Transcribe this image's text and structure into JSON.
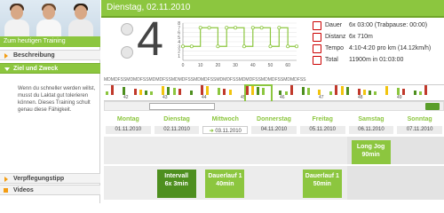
{
  "sidebar": {
    "title": "Zum heutigen Training",
    "items": [
      {
        "label": "Beschreibung",
        "active": false
      },
      {
        "label": "Ziel und Zweck",
        "active": true
      },
      {
        "label": "Verpflegungstipp",
        "active": false
      },
      {
        "label": "Videos",
        "active": false
      }
    ],
    "description": "Wenn du schneller werden willst, musst du Laktat gut tolerieren können. Dieses Training schult genau diese Fähigkeit."
  },
  "header": {
    "title": "Dienstag, 02.11.2010"
  },
  "workout_number": "4",
  "stats": [
    {
      "icon": "clock-icon",
      "label": "Dauer",
      "value": "6x 03:00 (Trabpause: 00:00)"
    },
    {
      "icon": "distance-icon",
      "label": "Distanz",
      "value": "6x 710m"
    },
    {
      "icon": "speed-icon",
      "label": "Tempo",
      "value": "4:10-4:20 pro km (14.12km/h)"
    },
    {
      "icon": "runner-icon",
      "label": "Total",
      "value": "11900m in 01:03:00"
    }
  ],
  "chart_data": {
    "type": "line",
    "x": [
      0,
      5,
      10,
      15,
      20,
      25,
      30,
      35,
      40,
      45,
      50,
      55,
      60,
      65
    ],
    "values": [
      3,
      3,
      7,
      7,
      3,
      7,
      7,
      3,
      7,
      7,
      3,
      7,
      3,
      3
    ],
    "xticks": [
      "0",
      "10",
      "20",
      "30",
      "40",
      "50",
      "60"
    ],
    "yticks": [
      "1",
      "2",
      "3",
      "4",
      "5",
      "6",
      "7",
      "8"
    ],
    "ylim": [
      0,
      8
    ],
    "xlim": [
      0,
      65
    ],
    "color": "#8cc63f"
  },
  "timeline": {
    "day_letters": "MDMDFSS",
    "weeks": [
      "42",
      "43",
      "44",
      "45",
      "46",
      "47",
      "48",
      "49"
    ],
    "months": [
      "Oktober '10",
      "November '10"
    ]
  },
  "calendar": {
    "days": [
      {
        "name": "Montag",
        "date": "01.11.2010",
        "today": false
      },
      {
        "name": "Dienstag",
        "date": "02.11.2010",
        "today": false
      },
      {
        "name": "Mittwoch",
        "date": "03.11.2010",
        "today": true
      },
      {
        "name": "Donnerstag",
        "date": "04.11.2010",
        "today": false
      },
      {
        "name": "Freitag",
        "date": "05.11.2010",
        "today": false
      },
      {
        "name": "Samstag",
        "date": "06.11.2010",
        "today": false
      },
      {
        "name": "Sonntag",
        "date": "07.11.2010",
        "today": false
      }
    ],
    "workouts": [
      {
        "day": "Samstag",
        "title": "Long Jog",
        "detail": "90min"
      },
      {
        "day": "Dienstag",
        "title": "Intervall",
        "detail": "6x 3min"
      },
      {
        "day": "Mittwoch",
        "title": "Dauerlauf 1",
        "detail": "40min"
      },
      {
        "day": "Freitag",
        "title": "Dauerlauf 1",
        "detail": "50min"
      }
    ]
  },
  "colors": {
    "accent": "#8cc63f",
    "accent_dark": "#4e8f1f",
    "stat_icon": "#cc0000"
  }
}
